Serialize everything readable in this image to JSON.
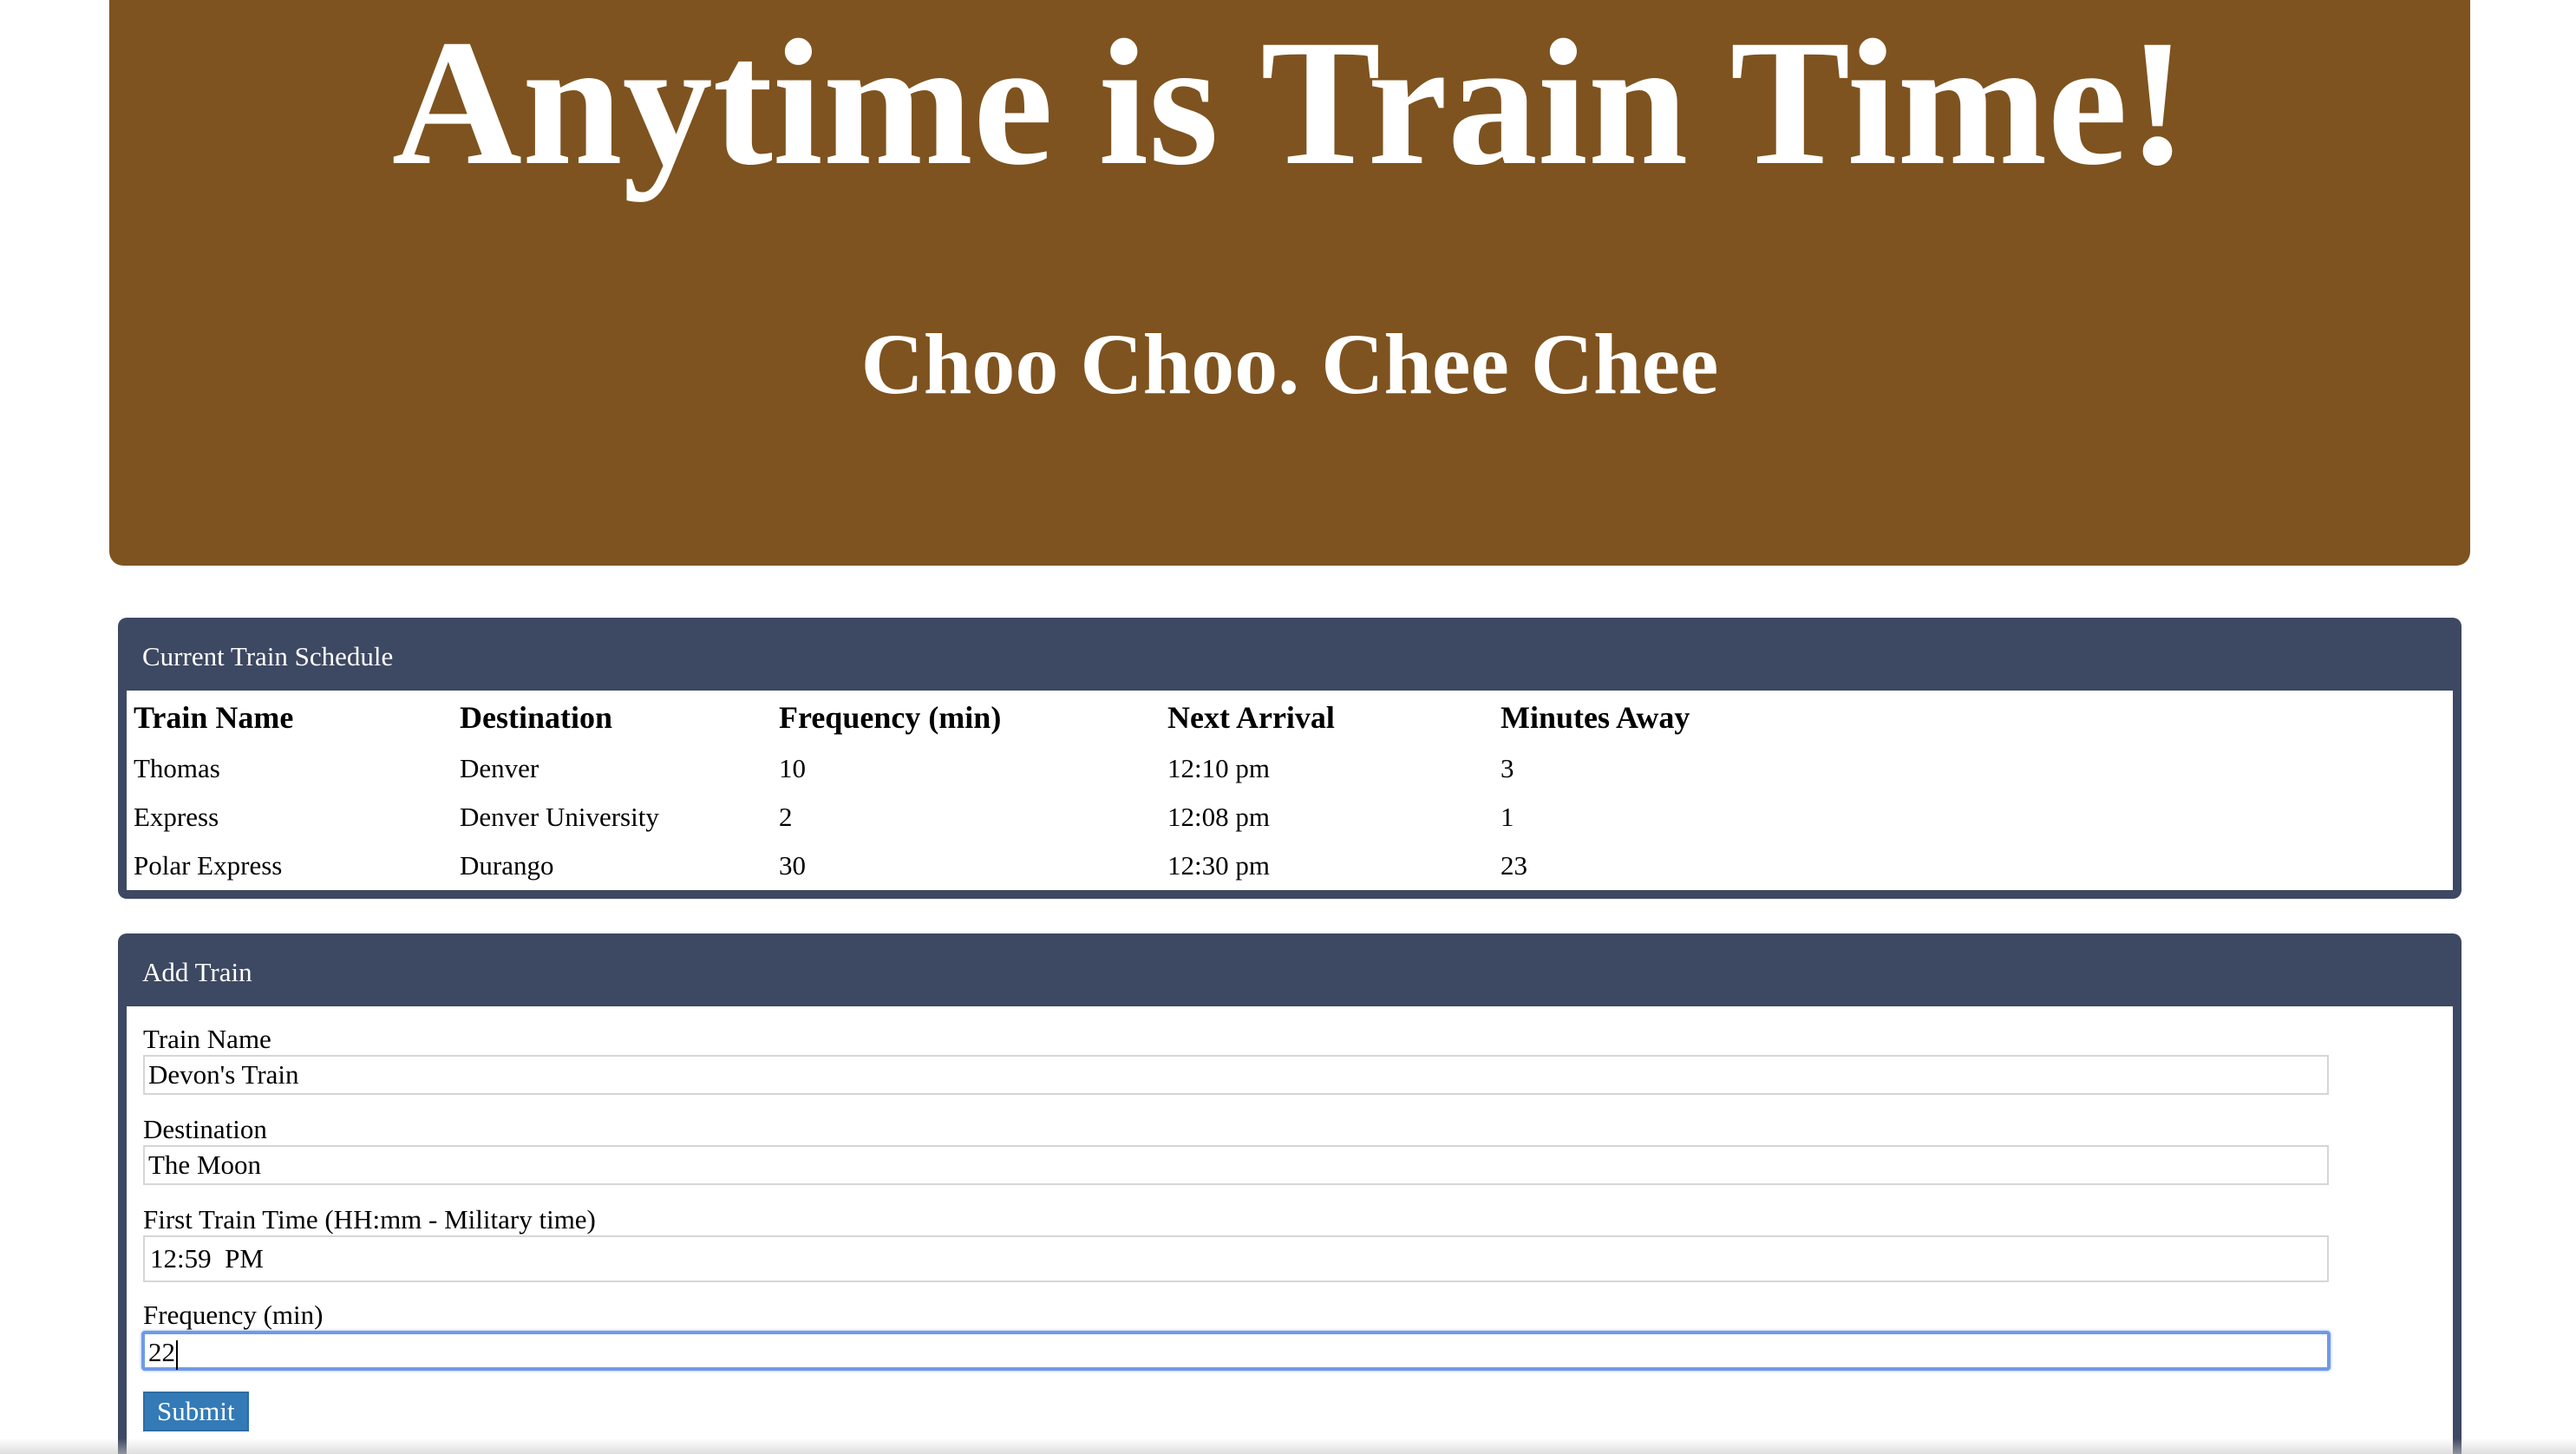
{
  "theme": {
    "jumbotron_bg": "#7e531f",
    "panel_bg": "#3d4862",
    "button_bg": "#337ab7",
    "focus_border": "#6f9ae6"
  },
  "header": {
    "title": "Anytime is Train Time!",
    "subtitle": "Choo Choo. Chee Chee"
  },
  "schedule": {
    "heading": "Current Train Schedule",
    "columns": [
      "Train Name",
      "Destination",
      "Frequency (min)",
      "Next Arrival",
      "Minutes Away"
    ],
    "rows": [
      [
        "Thomas",
        "Denver",
        "10",
        "12:10 pm",
        "3"
      ],
      [
        "Express",
        "Denver University",
        "2",
        "12:08 pm",
        "1"
      ],
      [
        "Polar Express",
        "Durango",
        "30",
        "12:30 pm",
        "23"
      ]
    ]
  },
  "add_train": {
    "heading": "Add Train",
    "fields": {
      "name": {
        "label": "Train Name",
        "value": "Devon's Train"
      },
      "destination": {
        "label": "Destination",
        "value": "The Moon"
      },
      "first_time": {
        "label": "First Train Time (HH:mm - Military time)",
        "value": "12:59  PM"
      },
      "frequency": {
        "label": "Frequency (min)",
        "value": "22"
      }
    },
    "submit_label": "Submit"
  }
}
